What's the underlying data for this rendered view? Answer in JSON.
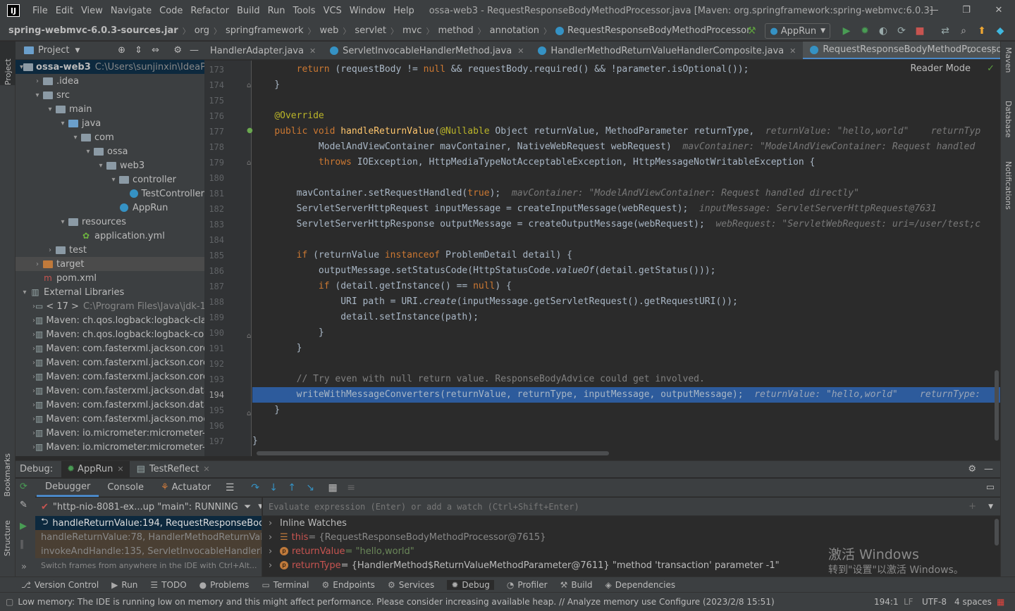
{
  "titlebar": {
    "logo": "IJ",
    "menu": [
      "File",
      "Edit",
      "View",
      "Navigate",
      "Code",
      "Refactor",
      "Build",
      "Run",
      "Tools",
      "VCS",
      "Window",
      "Help"
    ],
    "title": "ossa-web3 - RequestResponseBodyMethodProcessor.java [Maven: org.springframework:spring-webmvc:6.0.3]"
  },
  "navbar": {
    "crumbs": [
      "spring-webmvc-6.0.3-sources.jar",
      "org",
      "springframework",
      "web",
      "servlet",
      "mvc",
      "method",
      "annotation",
      "RequestResponseBodyMethodProcessor"
    ],
    "run_config": "AppRun"
  },
  "left_stripe": {
    "project": "Project",
    "bookmarks": "Bookmarks",
    "structure": "Structure"
  },
  "right_stripe": {
    "maven": "Maven",
    "database": "Database",
    "notifications": "Notifications"
  },
  "project_panel": {
    "title": "Project",
    "tree": [
      {
        "label": "ossa-web3",
        "extra": "C:\\Users\\sunjinxin\\IdeaPr",
        "indent": 0,
        "arrow": "▾",
        "icon": "folder",
        "root": true
      },
      {
        "label": ".idea",
        "indent": 1,
        "arrow": "›",
        "icon": "folder"
      },
      {
        "label": "src",
        "indent": 1,
        "arrow": "▾",
        "icon": "folder"
      },
      {
        "label": "main",
        "indent": 2,
        "arrow": "▾",
        "icon": "folder"
      },
      {
        "label": "java",
        "indent": 3,
        "arrow": "▾",
        "icon": "folder-blue"
      },
      {
        "label": "com",
        "indent": 4,
        "arrow": "▾",
        "icon": "folder"
      },
      {
        "label": "ossa",
        "indent": 5,
        "arrow": "▾",
        "icon": "folder"
      },
      {
        "label": "web3",
        "indent": 6,
        "arrow": "▾",
        "icon": "folder"
      },
      {
        "label": "controller",
        "indent": 7,
        "arrow": "▾",
        "icon": "folder"
      },
      {
        "label": "TestController",
        "indent": 8,
        "arrow": "",
        "icon": "class"
      },
      {
        "label": "AppRun",
        "indent": 7,
        "arrow": "",
        "icon": "class"
      },
      {
        "label": "resources",
        "indent": 3,
        "arrow": "▾",
        "icon": "folder"
      },
      {
        "label": "application.yml",
        "indent": 4,
        "arrow": "",
        "icon": "yml"
      },
      {
        "label": "test",
        "indent": 2,
        "arrow": "›",
        "icon": "folder"
      },
      {
        "label": "target",
        "indent": 1,
        "arrow": "›",
        "icon": "folder-orange",
        "selected": true
      },
      {
        "label": "pom.xml",
        "indent": 1,
        "arrow": "",
        "icon": "maven"
      },
      {
        "label": "External Libraries",
        "indent": 0,
        "arrow": "▾",
        "icon": "lib"
      },
      {
        "label": "< 17 >",
        "extra": "C:\\Program Files\\Java\\jdk-1",
        "indent": 1,
        "arrow": "›",
        "icon": "jdk"
      },
      {
        "label": "Maven: ch.qos.logback:logback-clas",
        "indent": 1,
        "arrow": "›",
        "icon": "lib"
      },
      {
        "label": "Maven: ch.qos.logback:logback-cor",
        "indent": 1,
        "arrow": "›",
        "icon": "lib"
      },
      {
        "label": "Maven: com.fasterxml.jackson.core:",
        "indent": 1,
        "arrow": "›",
        "icon": "lib"
      },
      {
        "label": "Maven: com.fasterxml.jackson.core:",
        "indent": 1,
        "arrow": "›",
        "icon": "lib"
      },
      {
        "label": "Maven: com.fasterxml.jackson.core:",
        "indent": 1,
        "arrow": "›",
        "icon": "lib"
      },
      {
        "label": "Maven: com.fasterxml.jackson.datat",
        "indent": 1,
        "arrow": "›",
        "icon": "lib"
      },
      {
        "label": "Maven: com.fasterxml.jackson.datat",
        "indent": 1,
        "arrow": "›",
        "icon": "lib"
      },
      {
        "label": "Maven: com.fasterxml.jackson.modu",
        "indent": 1,
        "arrow": "›",
        "icon": "lib"
      },
      {
        "label": "Maven: io.micrometer:micrometer-c",
        "indent": 1,
        "arrow": "›",
        "icon": "lib"
      },
      {
        "label": "Maven: io.micrometer:micrometer-c",
        "indent": 1,
        "arrow": "›",
        "icon": "lib"
      }
    ]
  },
  "editor_tabs": [
    {
      "label": "HandlerAdapter.java",
      "active": false
    },
    {
      "label": "ServletInvocableHandlerMethod.java",
      "active": false
    },
    {
      "label": "HandlerMethodReturnValueHandlerComposite.java",
      "active": false
    },
    {
      "label": "RequestResponseBodyMethodProcessor.java",
      "active": true
    }
  ],
  "editor": {
    "reader_mode": "Reader Mode",
    "current_line": "194",
    "lines": [
      {
        "n": "173",
        "html": "        <span class='kw'>return</span> (requestBody != <span class='kw'>null</span> &amp;&amp; requestBody.required() &amp;&amp; !parameter.isOptional());"
      },
      {
        "n": "174",
        "html": "    }"
      },
      {
        "n": "175",
        "html": ""
      },
      {
        "n": "176",
        "html": "    <span class='ann'>@Override</span>"
      },
      {
        "n": "177",
        "html": "    <span class='kw'>public void</span> <span class='fn'>handleReturnValue</span>(<span class='ann'>@Nullable</span> Object returnValue, MethodParameter returnType,  <span class='hint'>returnValue: \"hello,world\"    returnTyp</span>"
      },
      {
        "n": "178",
        "html": "            ModelAndViewContainer mavContainer, NativeWebRequest webRequest)  <span class='hint'>mavContainer: \"ModelAndViewContainer: Request handled</span>"
      },
      {
        "n": "179",
        "html": "            <span class='kw'>throws</span> IOException, HttpMediaTypeNotAcceptableException, HttpMessageNotWritableException {"
      },
      {
        "n": "180",
        "html": ""
      },
      {
        "n": "181",
        "html": "        mavContainer.setRequestHandled(<span class='kw'>true</span>);  <span class='hint'>mavContainer: \"ModelAndViewContainer: Request handled directly\"</span>"
      },
      {
        "n": "182",
        "html": "        ServletServerHttpRequest inputMessage = createInputMessage(webRequest);  <span class='hint'>inputMessage: ServletServerHttpRequest@7631</span>"
      },
      {
        "n": "183",
        "html": "        ServletServerHttpResponse outputMessage = createOutputMessage(webRequest);  <span class='hint'>webRequest: \"ServletWebRequest: uri=/user/test;c</span>"
      },
      {
        "n": "184",
        "html": ""
      },
      {
        "n": "185",
        "html": "        <span class='kw'>if</span> (returnValue <span class='kw'>instanceof</span> ProblemDetail detail) {"
      },
      {
        "n": "186",
        "html": "            outputMessage.setStatusCode(HttpStatusCode.<span class='it'>valueOf</span>(detail.getStatus()));"
      },
      {
        "n": "187",
        "html": "            <span class='kw'>if</span> (detail.getInstance() == <span class='kw'>null</span>) {"
      },
      {
        "n": "188",
        "html": "                URI path = URI.<span class='it'>create</span>(inputMessage.getServletRequest().getRequestURI());"
      },
      {
        "n": "189",
        "html": "                detail.setInstance(path);"
      },
      {
        "n": "190",
        "html": "            }"
      },
      {
        "n": "191",
        "html": "        }"
      },
      {
        "n": "192",
        "html": ""
      },
      {
        "n": "193",
        "html": "        <span class='cm'>// Try even with null return value. ResponseBodyAdvice could get involved.</span>"
      },
      {
        "n": "194",
        "html": "        writeWithMessageConverters(returnValue, returnType, inputMessage, outputMessage);  <span class='hint'>returnValue: \"hello,world\"    returnType:</span>",
        "hl": true
      },
      {
        "n": "195",
        "html": "    }"
      },
      {
        "n": "196",
        "html": ""
      },
      {
        "n": "197",
        "html": "}"
      }
    ]
  },
  "debug": {
    "label": "Debug:",
    "sessions": [
      "AppRun",
      "TestReflect"
    ],
    "tabs": [
      "Debugger",
      "Console",
      "Actuator"
    ],
    "thread": "\"http-nio-8081-ex...up \"main\": RUNNING",
    "eval_placeholder": "Evaluate expression (Enter) or add a watch (Ctrl+Shift+Enter)",
    "frames": [
      "handleReturnValue:194, RequestResponseBodyMet",
      "handleReturnValue:78, HandlerMethodReturnValue",
      "invokeAndHandle:135, ServletInvocableHandlerMet"
    ],
    "frames_hint": "Switch frames from anywhere in the IDE with Ctrl+Alt...",
    "variables": [
      {
        "name": "Inline Watches",
        "value": ""
      },
      {
        "name": "this",
        "value": " = {RequestResponseBodyMethodProcessor@7615}"
      },
      {
        "name": "returnValue",
        "value": " = \"hello,world\""
      },
      {
        "name": "returnType",
        "value": " = {HandlerMethod$ReturnValueMethodParameter@7611} \"method 'transaction' parameter -1\""
      }
    ],
    "watermark_1": "激活 Windows",
    "watermark_2": "转到\"设置\"以激活 Windows。"
  },
  "toolstrip": [
    "Version Control",
    "Run",
    "TODO",
    "Problems",
    "Terminal",
    "Endpoints",
    "Services",
    "Debug",
    "Profiler",
    "Build",
    "Dependencies"
  ],
  "statusbar": {
    "message": "Low memory: The IDE is running low on memory and this might affect performance. Please consider increasing available heap. // Analyze memory use   Configure (2023/2/8 15:51)",
    "position": "194:1",
    "line_sep": "LF",
    "encoding": "UTF-8",
    "indent": "4 spaces"
  }
}
